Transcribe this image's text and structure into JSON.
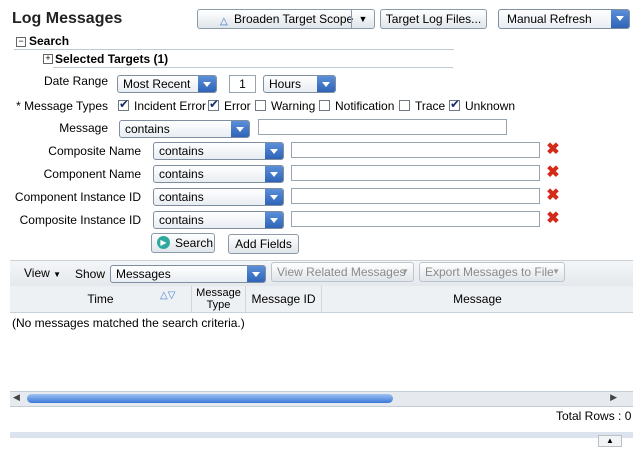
{
  "header": {
    "title": "Log Messages",
    "broaden_label": "Broaden Target Scope",
    "target_log_label": "Target Log Files...",
    "refresh_value": "Manual Refresh"
  },
  "search": {
    "section_label": "Search",
    "selected_targets_label": "Selected Targets (1)",
    "date_range_label": "Date Range",
    "date_range_value": "Most Recent",
    "count_value": "1",
    "unit_value": "Hours",
    "message_types_label": "* Message Types",
    "types": [
      {
        "label": "Incident Error",
        "checked": true
      },
      {
        "label": "Error",
        "checked": true
      },
      {
        "label": "Warning",
        "checked": false
      },
      {
        "label": "Notification",
        "checked": false
      },
      {
        "label": "Trace",
        "checked": false
      },
      {
        "label": "Unknown",
        "checked": true
      }
    ],
    "message_label": "Message",
    "message_op": "contains",
    "fields": [
      {
        "label": "Composite Name",
        "op": "contains"
      },
      {
        "label": "Component Name",
        "op": "contains"
      },
      {
        "label": "Component Instance ID",
        "op": "contains"
      },
      {
        "label": "Composite Instance ID",
        "op": "contains"
      }
    ],
    "search_button": "Search",
    "add_fields_button": "Add Fields"
  },
  "results": {
    "view_label": "View",
    "show_label": "Show",
    "show_value": "Messages",
    "view_related_label": "View Related Messages",
    "export_label": "Export Messages to File",
    "columns": [
      "Time",
      "Message Type",
      "Message ID",
      "Message"
    ],
    "empty_text": "(No messages matched the search criteria.)",
    "total_rows": "Total Rows : 0"
  }
}
